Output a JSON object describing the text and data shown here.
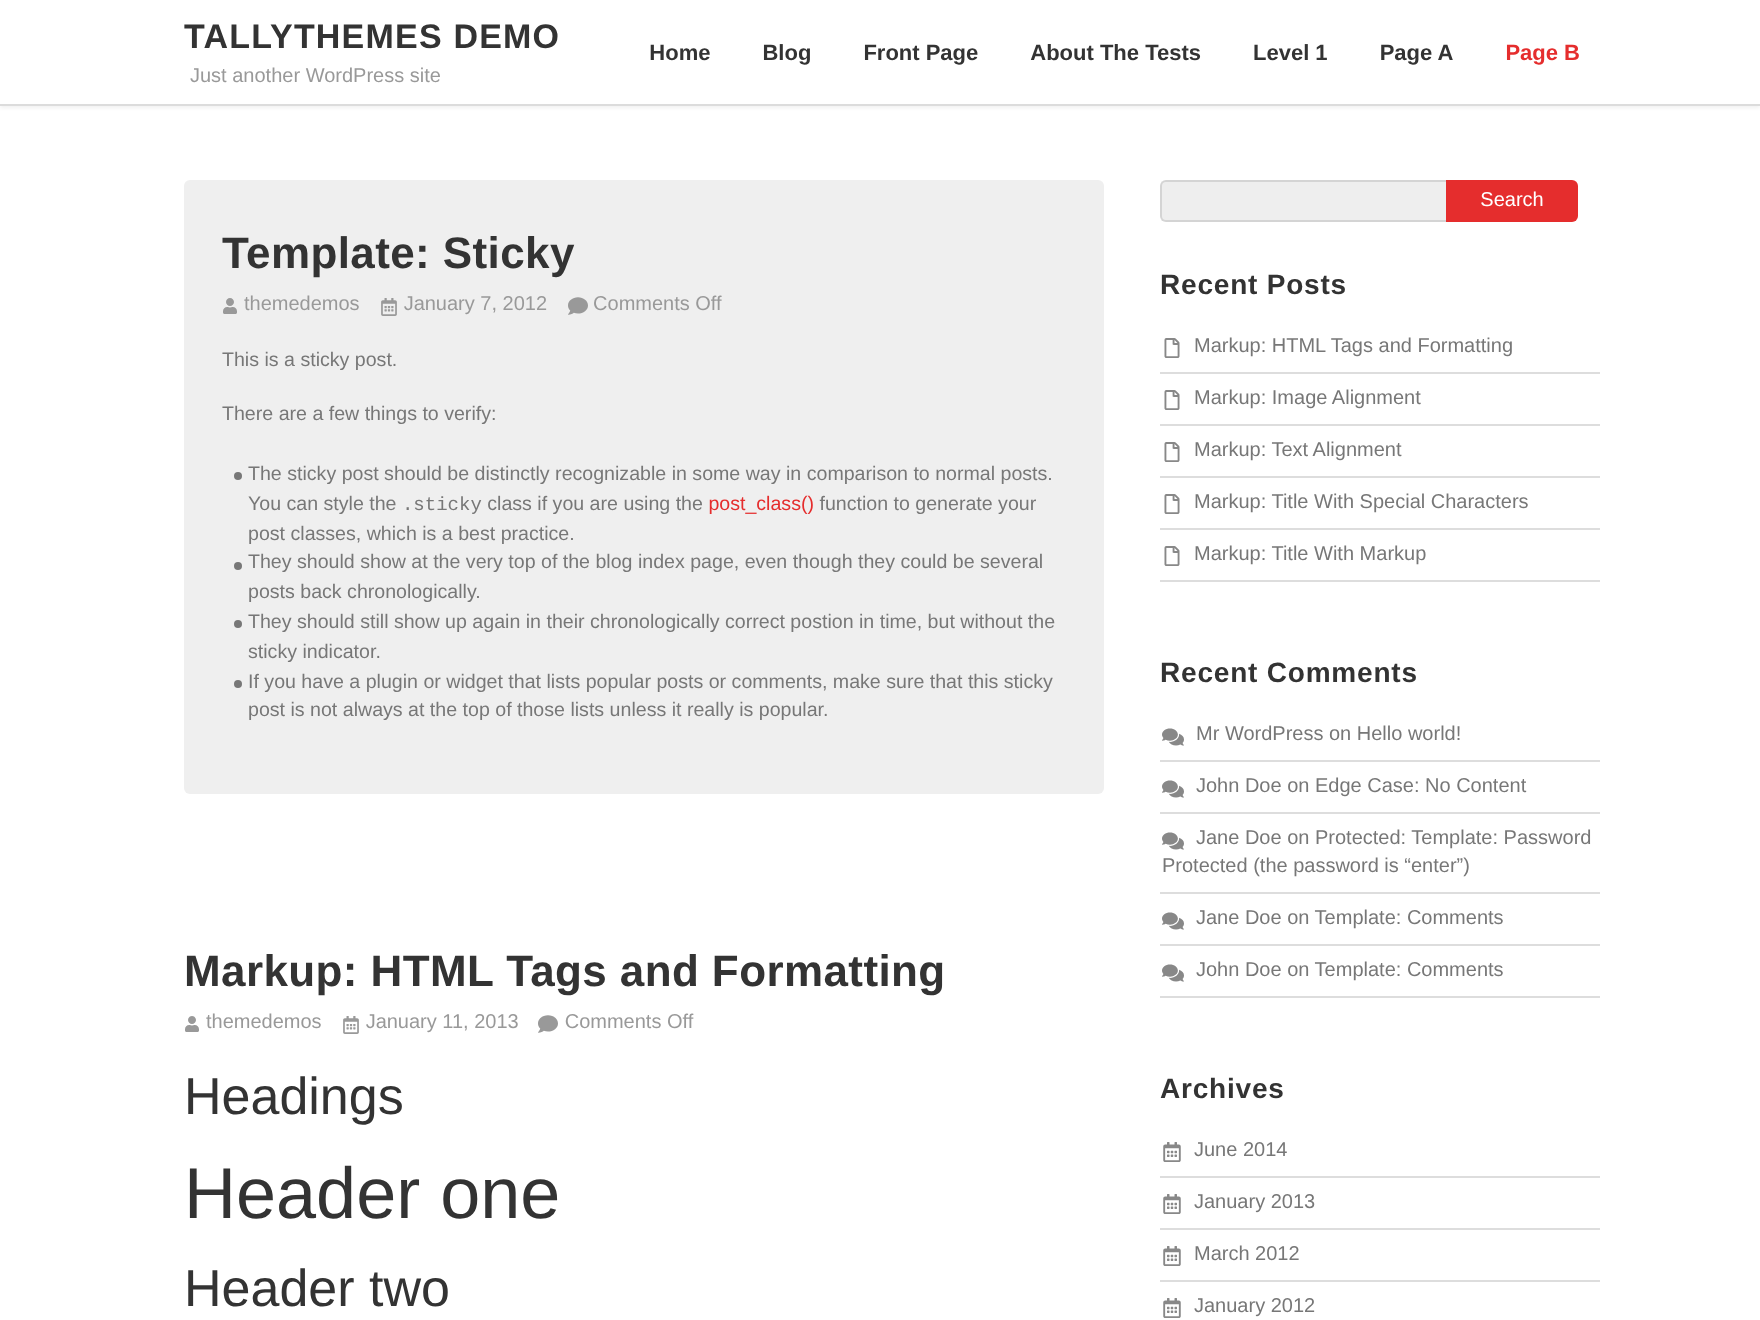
{
  "site": {
    "title": "TALLYTHEMES DEMO",
    "tagline": "Just another WordPress site"
  },
  "nav": [
    {
      "label": "Home",
      "selected": false
    },
    {
      "label": "Blog",
      "selected": false
    },
    {
      "label": "Front Page",
      "selected": false
    },
    {
      "label": "About The Tests",
      "selected": false
    },
    {
      "label": "Level 1",
      "selected": false
    },
    {
      "label": "Page A",
      "selected": false
    },
    {
      "label": "Page B",
      "selected": true
    }
  ],
  "posts": [
    {
      "kind": "sticky",
      "title": "Template: Sticky",
      "meta": [
        {
          "kind": "author",
          "text": "themedemos"
        },
        {
          "kind": "date",
          "text": "January 7, 2012"
        },
        {
          "kind": "comments",
          "text": "Comments Off"
        }
      ],
      "body": [
        {
          "kind": "paragraph",
          "text": "This is a sticky post."
        },
        {
          "kind": "paragraph",
          "text": "There are a few things to verify:"
        },
        {
          "kind": "list",
          "items": [
            [
              {
                "kind": "text",
                "text": "The sticky post should be distinctly recognizable in some way in comparison to normal posts. You can style the "
              },
              {
                "kind": "code",
                "text": ".sticky"
              },
              {
                "kind": "text",
                "text": " class if you are using the "
              },
              {
                "kind": "link",
                "text": "post_class()"
              },
              {
                "kind": "text",
                "text": " function to generate your post classes, which is a best practice."
              }
            ],
            [
              {
                "kind": "text",
                "text": "They should show at the very top of the blog index page, even though they could be several posts back chronologically."
              }
            ],
            [
              {
                "kind": "text",
                "text": "They should still show up again in their chronologically correct postion in time, but without the sticky indicator."
              }
            ],
            [
              {
                "kind": "text",
                "text": "If you have a plugin or widget that lists popular posts or comments, make sure that this sticky post is not always at the top of those lists unless it really is popular."
              }
            ]
          ]
        }
      ]
    },
    {
      "kind": "standard",
      "title": "Markup: HTML Tags and Formatting",
      "meta": [
        {
          "kind": "author",
          "text": "themedemos"
        },
        {
          "kind": "date",
          "text": "January 11, 2013"
        },
        {
          "kind": "comments",
          "text": "Comments Off"
        }
      ],
      "body": [
        {
          "kind": "section_heading",
          "text": "Headings"
        },
        {
          "kind": "h1",
          "text": "Header one"
        },
        {
          "kind": "h2",
          "text": "Header two"
        }
      ]
    }
  ],
  "sidebar": {
    "search": {
      "button": "Search"
    },
    "widgets": [
      {
        "kind": "posts",
        "title": "Recent Posts",
        "items": [
          "Markup: HTML Tags and Formatting",
          "Markup: Image Alignment",
          "Markup: Text Alignment",
          "Markup: Title With Special Characters",
          "Markup: Title With Markup"
        ]
      },
      {
        "kind": "comments",
        "title": "Recent Comments",
        "items": [
          "Mr WordPress on Hello world!",
          "John Doe on Edge Case: No Content",
          "Jane Doe on Protected: Template: Password Protected (the password is “enter”)",
          "Jane Doe on Template: Comments",
          "John Doe on Template: Comments"
        ]
      },
      {
        "kind": "archives",
        "title": "Archives",
        "items": [
          "June 2014",
          "January 2013",
          "March 2012",
          "January 2012"
        ]
      }
    ]
  }
}
